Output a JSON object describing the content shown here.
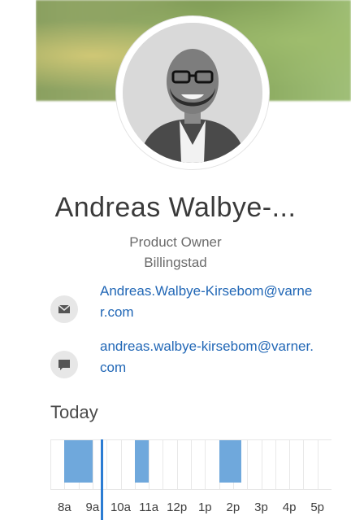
{
  "profile": {
    "name": "Andreas Walbye-...",
    "title": "Product Owner",
    "location": "Billingstad"
  },
  "contacts": [
    {
      "type": "email",
      "icon": "mail-icon",
      "text": "Andreas.Walbye-Kirsebom@varner.com"
    },
    {
      "type": "chat",
      "icon": "chat-icon",
      "text": "andreas.walbye-kirsebom@varner.com"
    }
  ],
  "schedule": {
    "heading": "Today",
    "hours": [
      "8a",
      "9a",
      "10a",
      "11a",
      "12p",
      "1p",
      "2p",
      "3p",
      "4p",
      "5p"
    ],
    "busy_blocks": [
      {
        "start_hour": 8.5,
        "end_hour": 9.5
      },
      {
        "start_hour": 11.0,
        "end_hour": 11.5
      },
      {
        "start_hour": 14.0,
        "end_hour": 14.8
      }
    ],
    "now_hour": 9.8,
    "colors": {
      "busy": "#6fa8dc",
      "now": "#2b7cd3",
      "link": "#2167b6"
    }
  }
}
